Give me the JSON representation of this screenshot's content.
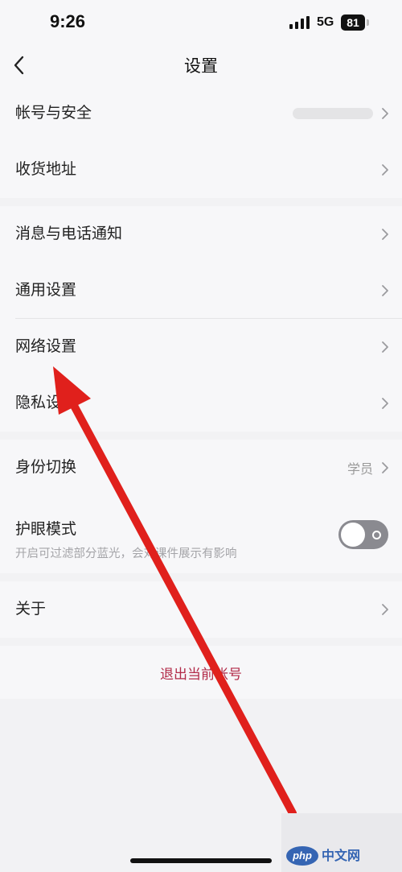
{
  "status_bar": {
    "time": "9:26",
    "network": "5G",
    "battery": "81"
  },
  "nav": {
    "title": "设置"
  },
  "groups": {
    "account": {
      "account_security": {
        "label": "帐号与安全"
      },
      "shipping_address": {
        "label": "收货地址"
      }
    },
    "general": {
      "notifications": {
        "label": "消息与电话通知"
      },
      "general_settings": {
        "label": "通用设置"
      },
      "network_settings": {
        "label": "网络设置"
      },
      "privacy_settings": {
        "label": "隐私设置"
      }
    },
    "profile": {
      "identity_switch": {
        "label": "身份切换",
        "value": "学员"
      },
      "eye_care": {
        "label": "护眼模式",
        "description": "开启可过滤部分蓝光，会对课件展示有影响",
        "enabled": false
      }
    },
    "about": {
      "label": "关于"
    }
  },
  "logout": {
    "label": "退出当前帐号"
  },
  "watermark": {
    "logo": "php",
    "text": "中文网"
  },
  "annotation": {
    "color": "#e0201c",
    "points_to": "网络设置"
  }
}
